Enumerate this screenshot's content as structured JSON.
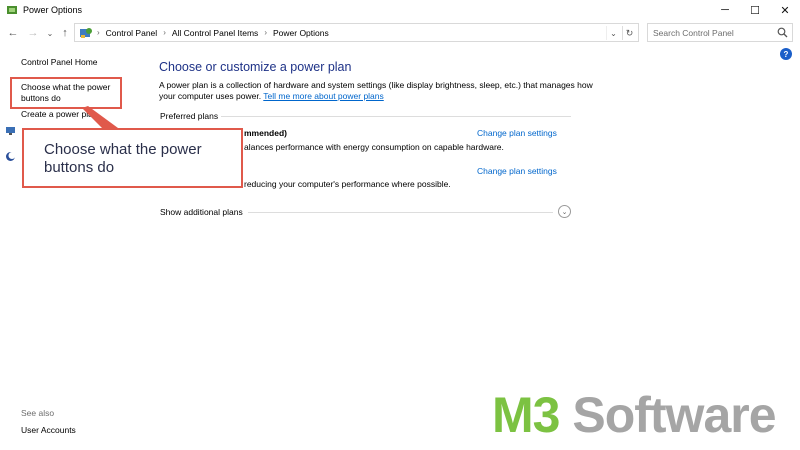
{
  "window": {
    "title": "Power Options",
    "controls": {
      "minimize": "─",
      "maximize": "☐",
      "close": "✕"
    }
  },
  "address": {
    "breadcrumbs": [
      "Control Panel",
      "All Control Panel Items",
      "Power Options"
    ],
    "separator": "›",
    "dropdown_glyph": "⌄",
    "refresh_glyph": "↻"
  },
  "nav": {
    "back": "←",
    "forward": "→",
    "recent": "⌄",
    "up": "↑"
  },
  "search": {
    "placeholder": "Search Control Panel",
    "value": ""
  },
  "help": {
    "glyph": "?"
  },
  "sidebar": {
    "home": "Control Panel Home",
    "items": [
      "Choose what the power buttons do",
      "Create a power plan"
    ],
    "see_also_label": "See also",
    "see_also_items": [
      "User Accounts"
    ]
  },
  "callout": {
    "text": "Choose what the power buttons do"
  },
  "main": {
    "title": "Choose or customize a power plan",
    "description": "A power plan is a collection of hardware and system settings (like display brightness, sleep, etc.) that manages how your computer uses power.",
    "more_link": "Tell me more about power plans",
    "preferred_label": "Preferred plans",
    "plans": [
      {
        "name_fragment": "mmended)",
        "desc_fragment": "alances performance with energy consumption on capable hardware.",
        "change_link": "Change plan settings"
      },
      {
        "name_fragment": "",
        "desc_fragment": "reducing your computer's performance where possible.",
        "change_link": "Change plan settings"
      }
    ],
    "show_additional": "Show additional plans",
    "show_chevron": "⌄"
  },
  "watermark": {
    "part1": "M3",
    "part2": " Software"
  },
  "colors": {
    "highlight": "#e0594b",
    "title_blue": "#1e3287",
    "link_blue": "#0066cc",
    "brand_green": "#7cc242",
    "brand_gray": "#a5a5a5"
  }
}
